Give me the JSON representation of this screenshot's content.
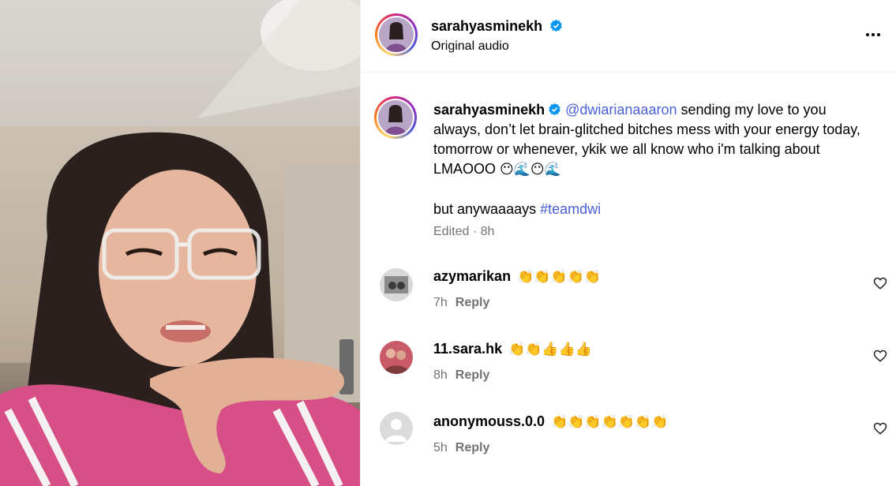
{
  "post": {
    "username": "sarahyasminekh",
    "audio_label": "Original audio"
  },
  "caption": {
    "username": "sarahyasminekh",
    "mention": "@dwiarianaaaron",
    "text": " sending my love to you always, don’t let brain-glitched bitches mess with your energy today, tomorrow or whenever, ykik we all know who i'm talking about LMAOOO ",
    "emojis": "😶🌊😶🌊",
    "line2_text": "but anywaaaays ",
    "hashtag": "#teamdwi",
    "edited_label": "Edited",
    "time": "8h"
  },
  "comments": [
    {
      "username": "azymarikan",
      "emojis": "👏👏👏👏👏",
      "time": "7h",
      "reply_label": "Reply"
    },
    {
      "username": "11.sara.hk",
      "emojis": "👏👏👍👍👍",
      "time": "8h",
      "reply_label": "Reply"
    },
    {
      "username": "anonymouss.0.0",
      "emojis": "👏👏👏👏👏👏👏",
      "time": "5h",
      "reply_label": "Reply"
    }
  ],
  "icons": {
    "verified": "verified-badge-icon",
    "more": "more-options-icon",
    "like": "heart-icon"
  },
  "colors": {
    "link": "#4a5fd8",
    "verified": "#0095f6",
    "muted": "#737373"
  }
}
